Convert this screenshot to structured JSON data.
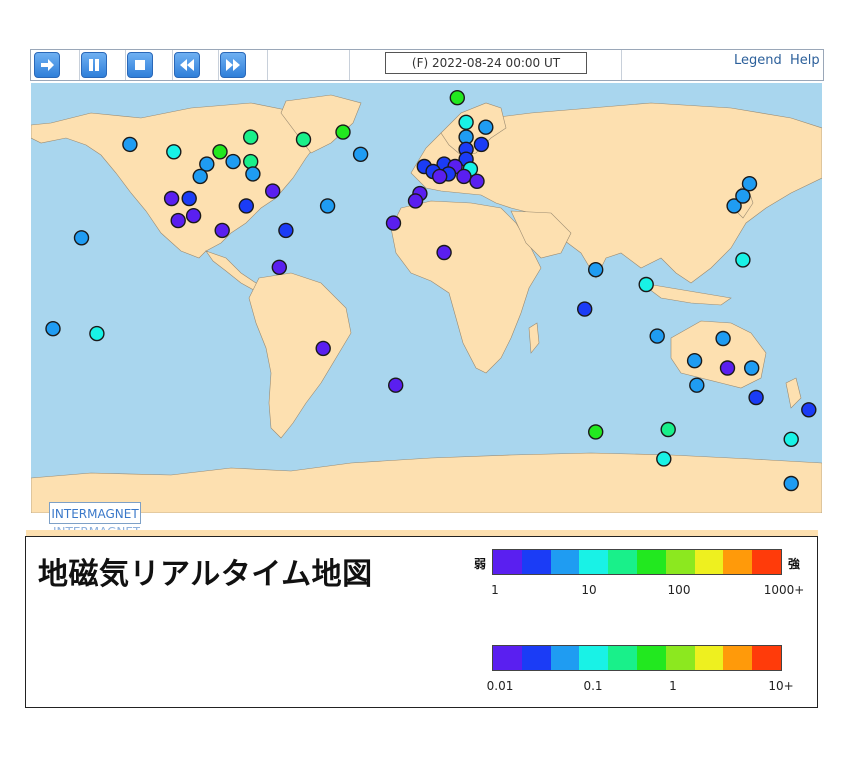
{
  "toolbar": {
    "buttons": [
      {
        "name": "play-button",
        "icon": "arrow-right-icon"
      },
      {
        "name": "pause-button",
        "icon": "pause-icon"
      },
      {
        "name": "stop-button",
        "icon": "stop-icon"
      },
      {
        "name": "rewind-button",
        "icon": "rewind-icon"
      },
      {
        "name": "fast-forward-button",
        "icon": "fast-forward-icon"
      }
    ],
    "timestamp": "(F) 2022-08-24 00:00 UT",
    "legend_label": "Legend",
    "help_label": "Help"
  },
  "map": {
    "ocean_color": "#a9d6ee",
    "land_color": "#fde0b0",
    "station_colors": [
      "#5a1ff0",
      "#1b3cf6",
      "#1f9cf2",
      "#19f2e6",
      "#19f08a",
      "#22e81f",
      "#8ce81f",
      "#eef01f",
      "#ff9a0a",
      "#ff3b0a"
    ],
    "stations": [
      {
        "lon": -135,
        "lat": 60,
        "level": 2
      },
      {
        "lon": -115,
        "lat": 57,
        "level": 3
      },
      {
        "lon": -94,
        "lat": 57,
        "level": 5
      },
      {
        "lon": -80,
        "lat": 63,
        "level": 4
      },
      {
        "lon": -56,
        "lat": 62,
        "level": 4
      },
      {
        "lon": -38,
        "lat": 65,
        "level": 5
      },
      {
        "lon": -30,
        "lat": 56,
        "level": 2
      },
      {
        "lon": -100,
        "lat": 52,
        "level": 2
      },
      {
        "lon": -103,
        "lat": 47,
        "level": 2
      },
      {
        "lon": -88,
        "lat": 53,
        "level": 2
      },
      {
        "lon": -80,
        "lat": 53,
        "level": 4
      },
      {
        "lon": -79,
        "lat": 48,
        "level": 2
      },
      {
        "lon": -116,
        "lat": 38,
        "level": 0
      },
      {
        "lon": -108,
        "lat": 38,
        "level": 1
      },
      {
        "lon": -70,
        "lat": 41,
        "level": 0
      },
      {
        "lon": -82,
        "lat": 35,
        "level": 1
      },
      {
        "lon": -113,
        "lat": 29,
        "level": 0
      },
      {
        "lon": -106,
        "lat": 31,
        "level": 0
      },
      {
        "lon": -93,
        "lat": 25,
        "level": 0
      },
      {
        "lon": -64,
        "lat": 25,
        "level": 1
      },
      {
        "lon": -67,
        "lat": 10,
        "level": 0
      },
      {
        "lon": -157,
        "lat": 22,
        "level": 2
      },
      {
        "lon": -45,
        "lat": 35,
        "level": 2
      },
      {
        "lon": -170,
        "lat": -15,
        "level": 2
      },
      {
        "lon": -150,
        "lat": -17,
        "level": 3
      },
      {
        "lon": -47,
        "lat": -23,
        "level": 0
      },
      {
        "lon": -14,
        "lat": -38,
        "level": 0
      },
      {
        "lon": 14,
        "lat": 79,
        "level": 5
      },
      {
        "lon": 18,
        "lat": 69,
        "level": 3
      },
      {
        "lon": 27,
        "lat": 67,
        "level": 2
      },
      {
        "lon": 18,
        "lat": 63,
        "level": 2
      },
      {
        "lon": 18,
        "lat": 58,
        "level": 1
      },
      {
        "lon": 25,
        "lat": 60,
        "level": 1
      },
      {
        "lon": 18,
        "lat": 54,
        "level": 1
      },
      {
        "lon": 8,
        "lat": 52,
        "level": 1
      },
      {
        "lon": -1,
        "lat": 51,
        "level": 1
      },
      {
        "lon": 13,
        "lat": 51,
        "level": 0
      },
      {
        "lon": 20,
        "lat": 50,
        "level": 3
      },
      {
        "lon": 3,
        "lat": 49,
        "level": 1
      },
      {
        "lon": 10,
        "lat": 48,
        "level": 1
      },
      {
        "lon": 17,
        "lat": 47,
        "level": 0
      },
      {
        "lon": 23,
        "lat": 45,
        "level": 0
      },
      {
        "lon": 6,
        "lat": 47,
        "level": 0
      },
      {
        "lon": -3,
        "lat": 40,
        "level": 0
      },
      {
        "lon": -5,
        "lat": 37,
        "level": 0
      },
      {
        "lon": -15,
        "lat": 28,
        "level": 0
      },
      {
        "lon": 8,
        "lat": 16,
        "level": 0
      },
      {
        "lon": 77,
        "lat": 9,
        "level": 2
      },
      {
        "lon": 72,
        "lat": -7,
        "level": 1
      },
      {
        "lon": 100,
        "lat": 3,
        "level": 3
      },
      {
        "lon": 140,
        "lat": 35,
        "level": 2
      },
      {
        "lon": 144,
        "lat": 39,
        "level": 2
      },
      {
        "lon": 147,
        "lat": 44,
        "level": 2
      },
      {
        "lon": 144,
        "lat": 13,
        "level": 3
      },
      {
        "lon": 105,
        "lat": -18,
        "level": 2
      },
      {
        "lon": 122,
        "lat": -28,
        "level": 2
      },
      {
        "lon": 135,
        "lat": -19,
        "level": 2
      },
      {
        "lon": 137,
        "lat": -31,
        "level": 0
      },
      {
        "lon": 148,
        "lat": -31,
        "level": 2
      },
      {
        "lon": 123,
        "lat": -38,
        "level": 2
      },
      {
        "lon": 150,
        "lat": -43,
        "level": 1
      },
      {
        "lon": 174,
        "lat": -48,
        "level": 1
      },
      {
        "lon": 166,
        "lat": -60,
        "level": 3
      },
      {
        "lon": 77,
        "lat": -57,
        "level": 5
      },
      {
        "lon": 110,
        "lat": -56,
        "level": 4
      },
      {
        "lon": 108,
        "lat": -68,
        "level": 3
      },
      {
        "lon": 166,
        "lat": -78,
        "level": 2
      }
    ]
  },
  "intermagnet": {
    "label": "INTERMAGNET",
    "ghost": "INTERMAGNET"
  },
  "legend": {
    "title": "地磁気リアルタイム地図",
    "weak_label": "弱",
    "strong_label": "強",
    "scale_colors": [
      "#5a1ff0",
      "#1b3cf6",
      "#1f9cf2",
      "#19f2e6",
      "#19f08a",
      "#22e81f",
      "#8ce81f",
      "#eef01f",
      "#ff9a0a",
      "#ff3b0a"
    ],
    "scale1_ticks": [
      "1",
      "10",
      "100",
      "1000+"
    ],
    "scale2_ticks": [
      "0.01",
      "0.1",
      "1",
      "10+"
    ]
  }
}
